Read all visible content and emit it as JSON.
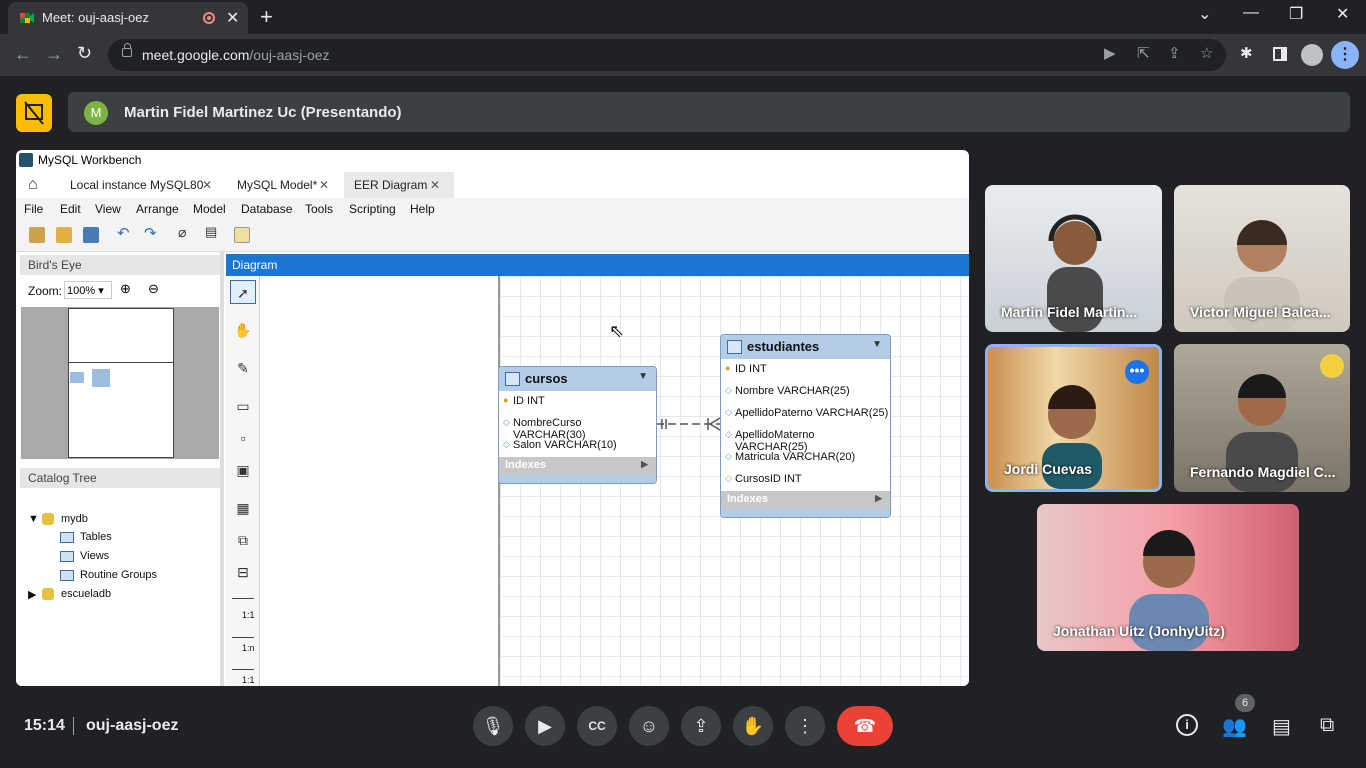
{
  "browser": {
    "tab_title": "Meet: ouj-aasj-oez",
    "tab_close": "✕",
    "new_tab": "+",
    "url_host": "meet.google.com",
    "url_path": "/ouj-aasj-oez",
    "window": {
      "minimize": "⌄",
      "min": "—",
      "restore": "❐",
      "close": "✕"
    }
  },
  "presenter": {
    "initial": "M",
    "label": "Martin Fidel Martinez Uc (Presentando)"
  },
  "workbench": {
    "title": "MySQL Workbench",
    "tabs": [
      {
        "label": "Local instance MySQL80"
      },
      {
        "label": "MySQL Model*"
      },
      {
        "label": "EER Diagram"
      }
    ],
    "tab_close": "✕",
    "menu": [
      "File",
      "Edit",
      "View",
      "Arrange",
      "Model",
      "Database",
      "Tools",
      "Scripting",
      "Help"
    ],
    "birds_eye": "Bird's Eye",
    "zoom_label": "Zoom:",
    "zoom_value": "100%",
    "catalog_tree": "Catalog Tree",
    "tree": {
      "db1": "mydb",
      "tables": "Tables",
      "views": "Views",
      "routines": "Routine Groups",
      "db2": "escueladb"
    },
    "diagram_header": "Diagram",
    "palette_labels": [
      "1:1",
      "1:n",
      "1:1"
    ],
    "entities": {
      "cursos": {
        "name": "cursos",
        "rows": [
          "ID INT",
          "NombreCurso VARCHAR(30)",
          "Salon VARCHAR(10)"
        ],
        "indexes": "Indexes"
      },
      "estudiantes": {
        "name": "estudiantes",
        "rows": [
          "ID INT",
          "Nombre VARCHAR(25)",
          "ApellidoPaterno VARCHAR(25)",
          "ApellidoMaterno VARCHAR(25)",
          "Matricula VARCHAR(20)",
          "CursosID INT"
        ],
        "indexes": "Indexes"
      }
    }
  },
  "participants": [
    {
      "name": "Martin Fidel Martin..."
    },
    {
      "name": "Victor Miguel Balca..."
    },
    {
      "name": "Jordi Cuevas"
    },
    {
      "name": "Fernando Magdiel C..."
    },
    {
      "name": "Jonathan Uitz (JonhyUitz)"
    }
  ],
  "bottom": {
    "time": "15:14",
    "meeting_code": "ouj-aasj-oez",
    "participant_count": "6"
  },
  "colors": {
    "accent": "#8ab4f8",
    "leave": "#ea4335",
    "present_stop": "#fbbc04"
  }
}
